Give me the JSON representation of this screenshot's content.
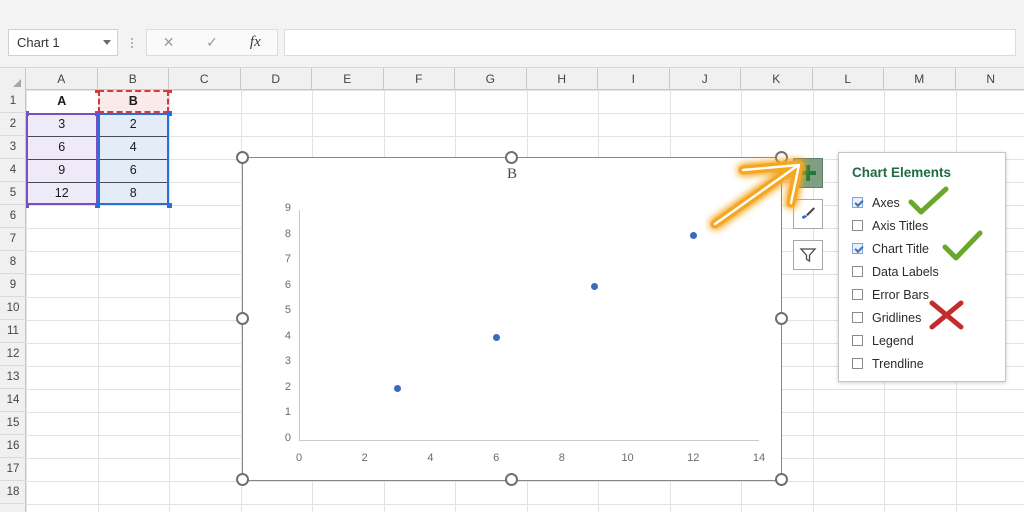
{
  "app": {
    "name_box_value": "Chart 1",
    "formula_value": "",
    "formula_placeholder": "",
    "cancel_icon": "x-icon",
    "enter_icon": "check-icon",
    "function_icon": "fx-icon",
    "fx_label": "fx"
  },
  "grid": {
    "columns": [
      "A",
      "B",
      "C",
      "D",
      "E",
      "F",
      "G",
      "H",
      "I",
      "J",
      "K",
      "L",
      "M",
      "N"
    ],
    "rows": [
      "1",
      "2",
      "3",
      "4",
      "5",
      "6",
      "7",
      "8",
      "9",
      "10",
      "11",
      "12",
      "13",
      "14",
      "15",
      "16",
      "17",
      "18"
    ],
    "cells": [
      {
        "col": "A",
        "row": "1",
        "value": "A",
        "header": true
      },
      {
        "col": "B",
        "row": "1",
        "value": "B",
        "header": true
      },
      {
        "col": "A",
        "row": "2",
        "value": "3"
      },
      {
        "col": "B",
        "row": "2",
        "value": "2"
      },
      {
        "col": "A",
        "row": "3",
        "value": "6"
      },
      {
        "col": "B",
        "row": "3",
        "value": "4"
      },
      {
        "col": "A",
        "row": "4",
        "value": "9"
      },
      {
        "col": "B",
        "row": "4",
        "value": "6"
      },
      {
        "col": "A",
        "row": "5",
        "value": "12"
      },
      {
        "col": "B",
        "row": "5",
        "value": "8"
      }
    ],
    "colors": {
      "series_a_border": "#7b4fc0",
      "series_b_border": "#2a6fd6",
      "category_border": "#d03b3b",
      "series_a_fill": "#efeaf7",
      "series_b_fill": "#e4edf7",
      "category_fill": "#fbeaea"
    }
  },
  "chart_data": {
    "type": "scatter",
    "title": "B",
    "xlabel": "",
    "ylabel": "",
    "x": [
      3,
      6,
      9,
      12
    ],
    "values": [
      2,
      4,
      6,
      8
    ],
    "series": [
      {
        "name": "B",
        "x": [
          3,
          6,
          9,
          12
        ],
        "values": [
          2,
          4,
          6,
          8
        ],
        "color": "#3a6bbf"
      }
    ],
    "xlim": [
      0,
      14
    ],
    "ylim": [
      0,
      9
    ],
    "xticks": [
      0,
      2,
      4,
      6,
      8,
      10,
      12,
      14
    ],
    "yticks": [
      0,
      1,
      2,
      3,
      4,
      5,
      6,
      7,
      8,
      9
    ],
    "grid": false,
    "legend": false,
    "marker_color": "#3a6bbf"
  },
  "chart_buttons": [
    {
      "id": "chart-elements",
      "icon": "plus-icon",
      "active": true
    },
    {
      "id": "chart-styles",
      "icon": "paintbrush-icon",
      "active": false
    },
    {
      "id": "chart-filters",
      "icon": "funnel-icon",
      "active": false
    }
  ],
  "chart_elements_panel": {
    "title": "Chart Elements",
    "items": [
      {
        "label": "Axes",
        "checked": true
      },
      {
        "label": "Axis Titles",
        "checked": false
      },
      {
        "label": "Chart Title",
        "checked": true
      },
      {
        "label": "Data Labels",
        "checked": false
      },
      {
        "label": "Error Bars",
        "checked": false
      },
      {
        "label": "Gridlines",
        "checked": false
      },
      {
        "label": "Legend",
        "checked": false
      },
      {
        "label": "Trendline",
        "checked": false
      }
    ]
  },
  "annotations": {
    "arrow_color": "#F5A623",
    "check_color": "#6AA82B",
    "cross_color": "#C42B2B",
    "checks_on": [
      "Axes",
      "Chart Title"
    ],
    "crosses_on": [
      "Gridlines"
    ]
  }
}
